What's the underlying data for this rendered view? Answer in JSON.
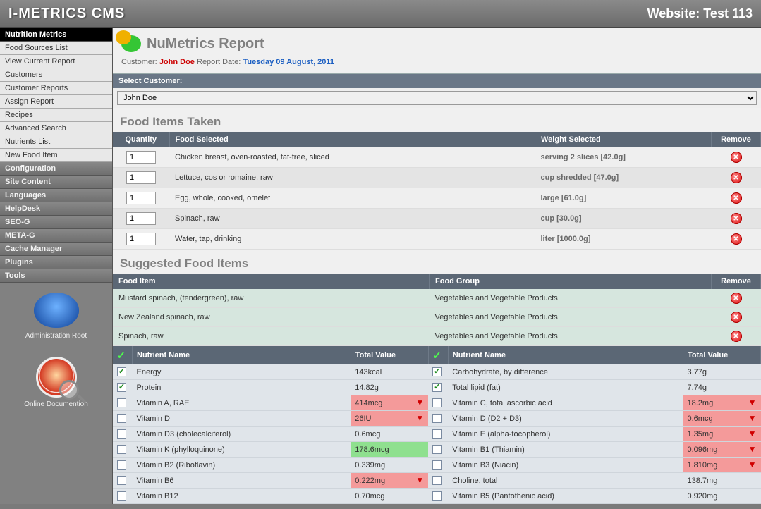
{
  "app": {
    "title": "I-METRICS CMS",
    "site_label": "Website: Test 113"
  },
  "nav": {
    "active_header": "Nutrition Metrics",
    "sub": [
      "Food Sources List",
      "View Current Report",
      "Customers",
      "Customer Reports",
      "Assign Report",
      "Recipes",
      "Advanced Search",
      "Nutrients List",
      "New Food Item"
    ],
    "sections": [
      "Configuration",
      "Site Content",
      "Languages",
      "HelpDesk",
      "SEO-G",
      "META-G",
      "Cache Manager",
      "Plugins",
      "Tools"
    ],
    "feat1": "Administration Root",
    "feat2": "Online Documention"
  },
  "page": {
    "title": "NuMetrics Report",
    "meta_customer_label": "Customer:",
    "meta_customer": "John Doe",
    "meta_date_label": "Report Date:",
    "meta_date": "Tuesday 09 August, 2011",
    "select_label": "Select Customer:",
    "select_value": "John Doe"
  },
  "foods": {
    "title": "Food Items Taken",
    "hdr_qty": "Quantity",
    "hdr_food": "Food Selected",
    "hdr_weight": "Weight Selected",
    "hdr_remove": "Remove",
    "rows": [
      {
        "qty": "1",
        "food": "Chicken breast, oven-roasted, fat-free, sliced",
        "weight": "serving 2 slices [42.0g]"
      },
      {
        "qty": "1",
        "food": "Lettuce, cos or romaine, raw",
        "weight": "cup shredded [47.0g]"
      },
      {
        "qty": "1",
        "food": "Egg, whole, cooked, omelet",
        "weight": "large [61.0g]"
      },
      {
        "qty": "1",
        "food": "Spinach, raw",
        "weight": "cup [30.0g]"
      },
      {
        "qty": "1",
        "food": "Water, tap, drinking",
        "weight": "liter [1000.0g]"
      }
    ]
  },
  "sugg": {
    "title": "Suggested Food Items",
    "hdr_item": "Food Item",
    "hdr_group": "Food Group",
    "hdr_remove": "Remove",
    "rows": [
      {
        "item": "Mustard spinach, (tendergreen), raw",
        "group": "Vegetables and Vegetable Products"
      },
      {
        "item": "New Zealand spinach, raw",
        "group": "Vegetables and Vegetable Products"
      },
      {
        "item": "Spinach, raw",
        "group": "Vegetables and Vegetable Products"
      }
    ]
  },
  "nutr": {
    "hdr_name": "Nutrient Name",
    "hdr_val": "Total Value",
    "left": [
      {
        "chk": true,
        "name": "Energy",
        "val": "143kcal",
        "bg": "",
        "arrow": false
      },
      {
        "chk": true,
        "name": "Protein",
        "val": "14.82g",
        "bg": "",
        "arrow": false
      },
      {
        "chk": false,
        "name": "Vitamin A, RAE",
        "val": "414mcg",
        "bg": "warn",
        "arrow": true
      },
      {
        "chk": false,
        "name": "Vitamin D",
        "val": "26IU",
        "bg": "warn",
        "arrow": true
      },
      {
        "chk": false,
        "name": "Vitamin D3 (cholecalciferol)",
        "val": "0.6mcg",
        "bg": "",
        "arrow": false
      },
      {
        "chk": false,
        "name": "Vitamin K (phylloquinone)",
        "val": "178.6mcg",
        "bg": "good",
        "arrow": false
      },
      {
        "chk": false,
        "name": "Vitamin B2 (Riboflavin)",
        "val": "0.339mg",
        "bg": "",
        "arrow": false
      },
      {
        "chk": false,
        "name": "Vitamin B6",
        "val": "0.222mg",
        "bg": "warn",
        "arrow": true
      },
      {
        "chk": false,
        "name": "Vitamin B12",
        "val": "0.70mcg",
        "bg": "",
        "arrow": false
      }
    ],
    "right": [
      {
        "chk": true,
        "name": "Carbohydrate, by difference",
        "val": "3.77g",
        "bg": "",
        "arrow": false
      },
      {
        "chk": true,
        "name": "Total lipid (fat)",
        "val": "7.74g",
        "bg": "",
        "arrow": false
      },
      {
        "chk": false,
        "name": "Vitamin C, total ascorbic acid",
        "val": "18.2mg",
        "bg": "warn",
        "arrow": true
      },
      {
        "chk": false,
        "name": "Vitamin D (D2 + D3)",
        "val": "0.6mcg",
        "bg": "warn",
        "arrow": true
      },
      {
        "chk": false,
        "name": "Vitamin E (alpha-tocopherol)",
        "val": "1.35mg",
        "bg": "warn",
        "arrow": true
      },
      {
        "chk": false,
        "name": "Vitamin B1 (Thiamin)",
        "val": "0.096mg",
        "bg": "warn",
        "arrow": true
      },
      {
        "chk": false,
        "name": "Vitamin B3 (Niacin)",
        "val": "1.810mg",
        "bg": "warn",
        "arrow": true
      },
      {
        "chk": false,
        "name": "Choline, total",
        "val": "138.7mg",
        "bg": "",
        "arrow": false
      },
      {
        "chk": false,
        "name": "Vitamin B5 (Pantothenic acid)",
        "val": "0.920mg",
        "bg": "",
        "arrow": false
      }
    ]
  }
}
